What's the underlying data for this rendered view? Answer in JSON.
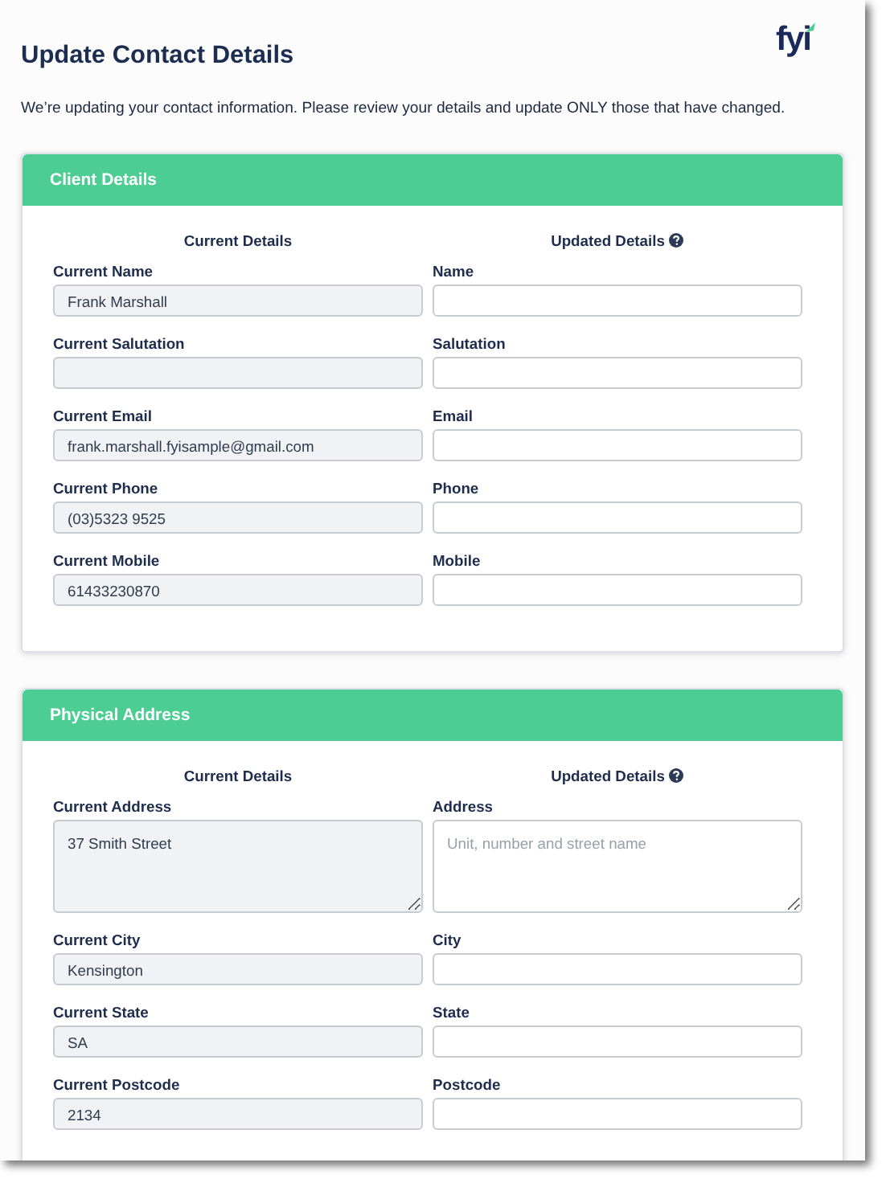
{
  "header": {
    "title": "Update Contact Details",
    "logo": "fyi"
  },
  "intro": "We’re updating your contact information. Please review your details and update ONLY those that have changed.",
  "sections": [
    {
      "title": "Client Details",
      "current_heading": "Current Details",
      "updated_heading": "Updated Details",
      "rows": [
        {
          "kind": "input",
          "current_label": "Current Name",
          "current_value": "Frank Marshall",
          "label": "Name"
        },
        {
          "kind": "input",
          "current_label": "Current Salutation",
          "label": "Salutation"
        },
        {
          "kind": "input",
          "current_label": "Current Email",
          "current_value": "frank.marshall.fyisample@gmail.com",
          "label": "Email"
        },
        {
          "kind": "input",
          "current_label": "Current Phone",
          "current_value": "(03)5323 9525",
          "label": "Phone"
        },
        {
          "kind": "input",
          "current_label": "Current Mobile",
          "current_value": "61433230870",
          "label": "Mobile"
        }
      ]
    },
    {
      "title": "Physical Address",
      "current_heading": "Current Details",
      "updated_heading": "Updated Details",
      "rows": [
        {
          "kind": "textarea",
          "current_label": "Current Address",
          "current_value": "37 Smith Street",
          "label": "Address",
          "placeholder": "Unit, number and street name"
        },
        {
          "kind": "input",
          "current_label": "Current City",
          "current_value": "Kensington",
          "label": "City"
        },
        {
          "kind": "input",
          "current_label": "Current State",
          "current_value": "SA",
          "label": "State"
        },
        {
          "kind": "input",
          "current_label": "Current Postcode",
          "current_value": "2134",
          "label": "Postcode"
        }
      ]
    }
  ]
}
